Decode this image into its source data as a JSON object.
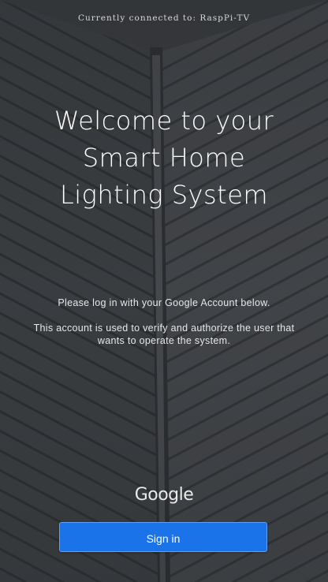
{
  "status": {
    "connection_text": "Currently connected to: RaspPi-TV"
  },
  "hero": {
    "title_line1": "Welcome to your",
    "title_line2": "Smart Home",
    "title_line3": "Lighting System"
  },
  "instructions": {
    "line1": "Please log in with your Google Account below.",
    "line2": "This account is used to verify and authorize the user that wants to operate the system."
  },
  "auth": {
    "provider_logo_text": "Google",
    "signin_label": "Sign in"
  },
  "colors": {
    "background": "#3a3d40",
    "button": "#1a73e8",
    "text": "#ffffff"
  }
}
